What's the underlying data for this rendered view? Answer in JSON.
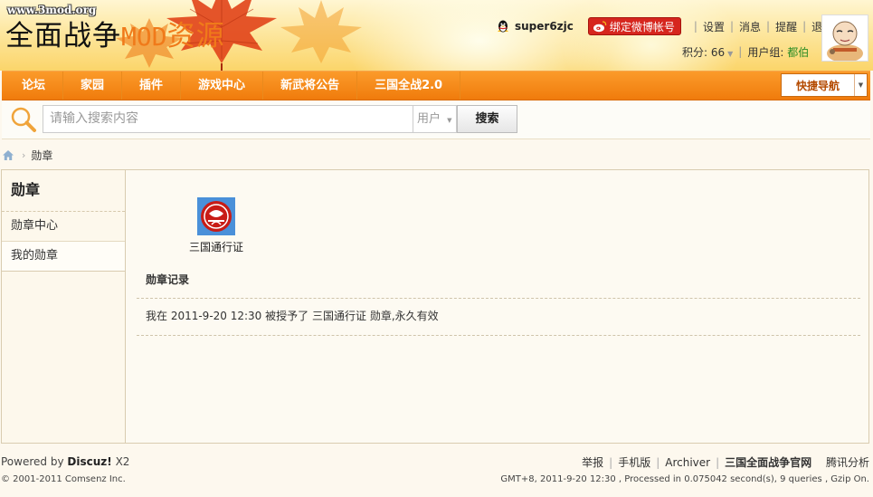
{
  "header": {
    "logo_url_text": "www.3mod.org",
    "logo_part1": "全面战争",
    "logo_part2": "MOD",
    "logo_part3": "资源",
    "username": "super6zjc",
    "weibo_bind_label": "绑定微博帐号",
    "links": {
      "settings": "设置",
      "messages": "消息",
      "reminders": "提醒",
      "logout": "退出"
    },
    "points_label": "积分: 66",
    "group_label": "用户组:",
    "group_value": "都伯",
    "colors": {
      "group_value": "#2a8c24",
      "logo_accent": "#f07a1a"
    }
  },
  "nav": {
    "items": [
      "论坛",
      "家园",
      "插件",
      "游戏中心",
      "新武将公告",
      "三国全战2.0"
    ],
    "quick_nav_label": "快捷导航",
    "bar_color": "#f07b0c"
  },
  "search": {
    "placeholder": "请输入搜索内容",
    "type_selected": "用户",
    "button_label": "搜索"
  },
  "breadcrumb": {
    "current": "勋章"
  },
  "sidebar": {
    "title": "勋章",
    "items": [
      "勋章中心",
      "我的勋章"
    ]
  },
  "main": {
    "medal_name": "三国通行证",
    "record_title": "勋章记录",
    "record_prefix": "我在 2011-9-20 12:30 被授予了",
    "record_medal": "三国通行证",
    "record_suffix": "勋章,永久有效"
  },
  "footer": {
    "powered_prefix": "Powered by",
    "powered_brand": "Discuz!",
    "powered_version": "X2",
    "copyright": "© 2001-2011 Comsenz Inc.",
    "links": [
      "举报",
      "手机版",
      "Archiver",
      "三国全面战争官网",
      "腾讯分析"
    ],
    "stats": "GMT+8, 2011-9-20 12:30 , Processed in 0.075042 second(s), 9 queries , Gzip On."
  }
}
